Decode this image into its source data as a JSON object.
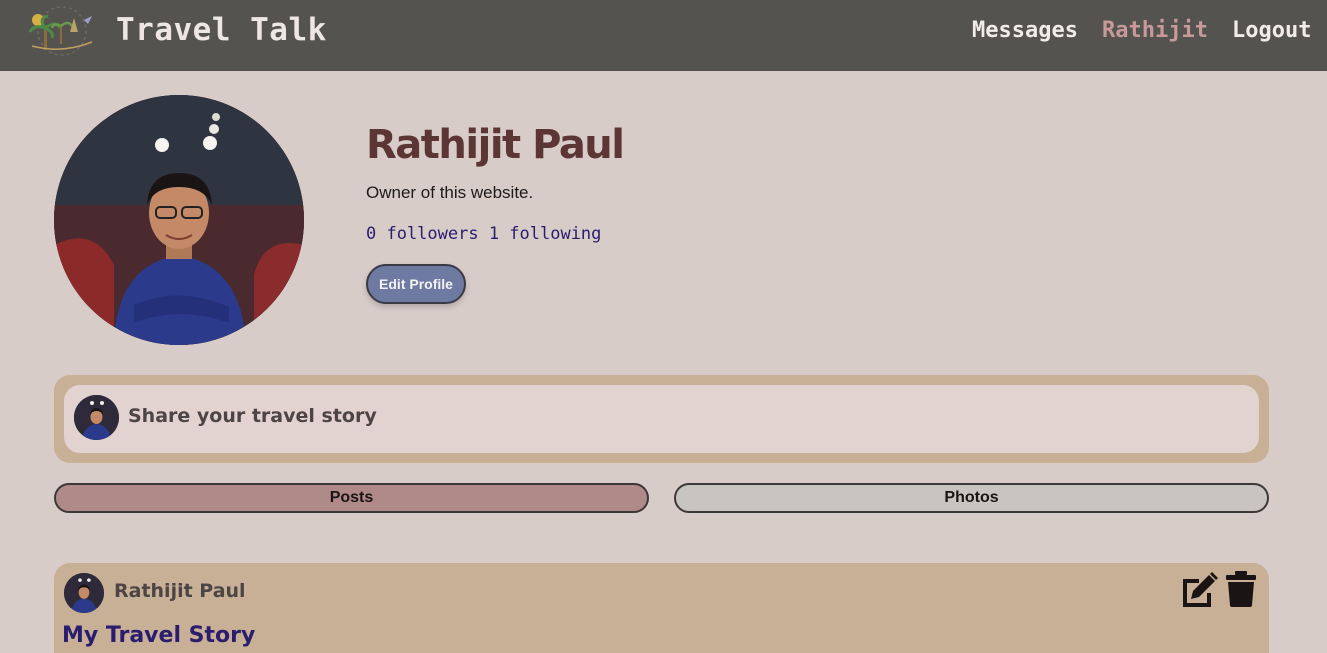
{
  "header": {
    "brand": "Travel Talk",
    "nav": {
      "messages": "Messages",
      "user": "Rathijit",
      "logout": "Logout"
    }
  },
  "profile": {
    "name": "Rathijit Paul",
    "bio": "Owner of this website.",
    "follow_stats": "0 followers 1 following",
    "edit_button": "Edit Profile"
  },
  "composer": {
    "placeholder": "Share your travel story"
  },
  "tabs": [
    {
      "label": "Posts",
      "active": true
    },
    {
      "label": "Photos",
      "active": false
    }
  ],
  "post": {
    "author": "Rathijit Paul",
    "title": "My Travel Story"
  },
  "colors": {
    "topbar": "#545350",
    "background": "#d8ccc8",
    "card": "#c8b096",
    "accent_name": "#5c3535",
    "active_tab": "#b08a88",
    "inactive_tab": "#c8c5c1",
    "edit_button": "#6f7aa3"
  }
}
